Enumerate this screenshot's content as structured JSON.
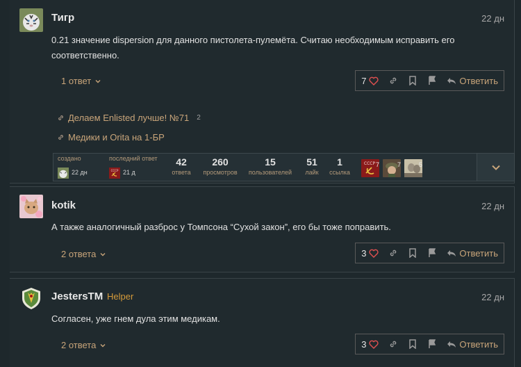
{
  "posts": [
    {
      "username": "Тигр",
      "date": "22 дн",
      "text": "0.21 значение dispersion для данного пистолета-пулемёта. Считаю необходимым исправить его соответственно.",
      "replies": "1 ответ",
      "likes": "7",
      "reply_label": "Ответить",
      "links": [
        {
          "title": "Делаем Enlisted лучше! №71",
          "count": "2"
        },
        {
          "title": "Медики и Orita на 1-БР",
          "count": ""
        }
      ],
      "summary": {
        "created_label": "создано",
        "created_time": "22 дн",
        "last_label": "последний ответ",
        "last_time": "21 д",
        "stats": [
          {
            "num": "42",
            "label": "ответа"
          },
          {
            "num": "260",
            "label": "просмотров"
          },
          {
            "num": "15",
            "label": "пользователей"
          },
          {
            "num": "51",
            "label": "лайк"
          },
          {
            "num": "1",
            "label": "ссылка"
          }
        ],
        "participant_counts": [
          "7",
          "7",
          "5"
        ]
      }
    },
    {
      "username": "kotik",
      "date": "22 дн",
      "text": "А также аналогичный разброс у Томпсона “Сухой закон”, его бы тоже поправить.",
      "replies": "2 ответа",
      "likes": "3",
      "reply_label": "Ответить"
    },
    {
      "username": "JestersTM",
      "title": "Helper",
      "date": "22 дн",
      "text": "Согласен, уже гнем дула этим медикам.",
      "replies": "2 ответа",
      "likes": "3",
      "reply_label": "Ответить"
    }
  ],
  "colors": {
    "background": "#1e282c",
    "accent": "#c9a57a",
    "heart": "#e05050",
    "helper": "#d49a3a"
  }
}
